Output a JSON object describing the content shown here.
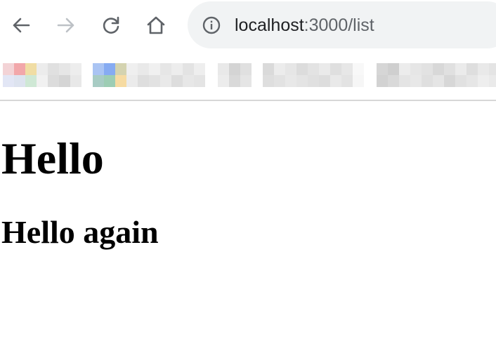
{
  "browser": {
    "nav": {
      "back_icon": "arrow-left-icon",
      "forward_icon": "arrow-right-icon",
      "reload_icon": "reload-icon",
      "home_icon": "home-icon",
      "forward_disabled": true
    },
    "omnibox": {
      "info_icon": "info-icon",
      "url_host": "localhost",
      "url_rest": ":3000/list"
    },
    "bookmarks_blurred": true
  },
  "page": {
    "heading1": "Hello",
    "heading2": "Hello again"
  }
}
